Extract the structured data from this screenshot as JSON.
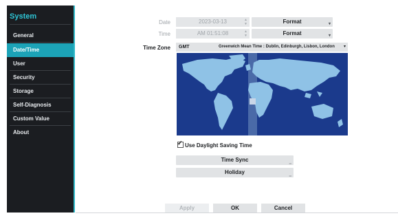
{
  "sidebar": {
    "title": "System",
    "items": [
      {
        "label": "General"
      },
      {
        "label": "Date/Time"
      },
      {
        "label": "User"
      },
      {
        "label": "Security"
      },
      {
        "label": "Storage"
      },
      {
        "label": "Self-Diagnosis"
      },
      {
        "label": "Custom Value"
      },
      {
        "label": "About"
      }
    ],
    "active": "Date/Time"
  },
  "form": {
    "date_label": "Date",
    "date_value": "2023-03-13",
    "date_format": "Format",
    "time_label": "Time",
    "time_value": "AM 01:51:08",
    "time_format": "Format",
    "timezone_label": "Time Zone",
    "timezone_code": "GMT",
    "timezone_name": "Greenwich Mean Time : Dublin, Edinburgh, Lisbon, London",
    "dst_label": "Use Daylight Saving Time",
    "dst_checked": true,
    "time_sync": "Time Sync",
    "holiday": "Holiday"
  },
  "actions": {
    "apply": "Apply",
    "ok": "OK",
    "cancel": "Cancel"
  },
  "colors": {
    "accent": "#2fb9c9",
    "active_item": "#1ca3b7",
    "sidebar_bg": "#1b1d21",
    "ocean": "#1b3a8c",
    "land": "#8fc2e6",
    "zone_band": "#4a6aa8"
  }
}
